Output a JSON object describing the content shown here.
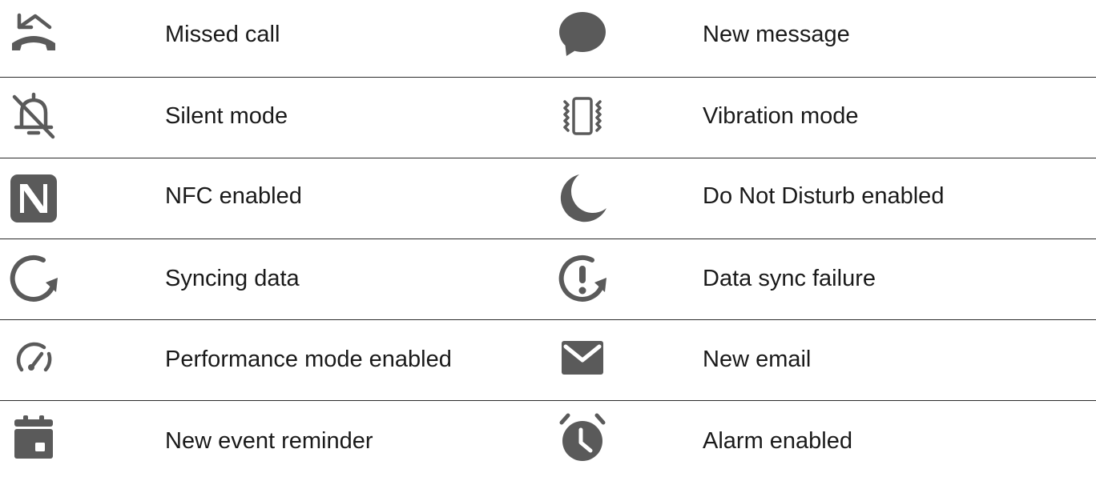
{
  "rows": [
    {
      "left": {
        "icon": "missed-call-icon",
        "label": "Missed call"
      },
      "right": {
        "icon": "message-bubble-icon",
        "label": "New message"
      }
    },
    {
      "left": {
        "icon": "bell-off-icon",
        "label": "Silent mode"
      },
      "right": {
        "icon": "vibration-icon",
        "label": "Vibration mode"
      }
    },
    {
      "left": {
        "icon": "nfc-icon",
        "label": "NFC enabled"
      },
      "right": {
        "icon": "moon-icon",
        "label": "Do Not Disturb enabled"
      }
    },
    {
      "left": {
        "icon": "sync-icon",
        "label": "Syncing data"
      },
      "right": {
        "icon": "sync-failure-icon",
        "label": "Data sync failure"
      }
    },
    {
      "left": {
        "icon": "speedometer-icon",
        "label": "Performance mode enabled"
      },
      "right": {
        "icon": "envelope-icon",
        "label": "New email"
      }
    },
    {
      "left": {
        "icon": "calendar-icon",
        "label": "New event reminder"
      },
      "right": {
        "icon": "alarm-clock-icon",
        "label": "Alarm enabled"
      }
    }
  ],
  "colors": {
    "icon": "#5a5a5a",
    "text": "#1a1a1a",
    "divider": "#2a2a2a"
  }
}
